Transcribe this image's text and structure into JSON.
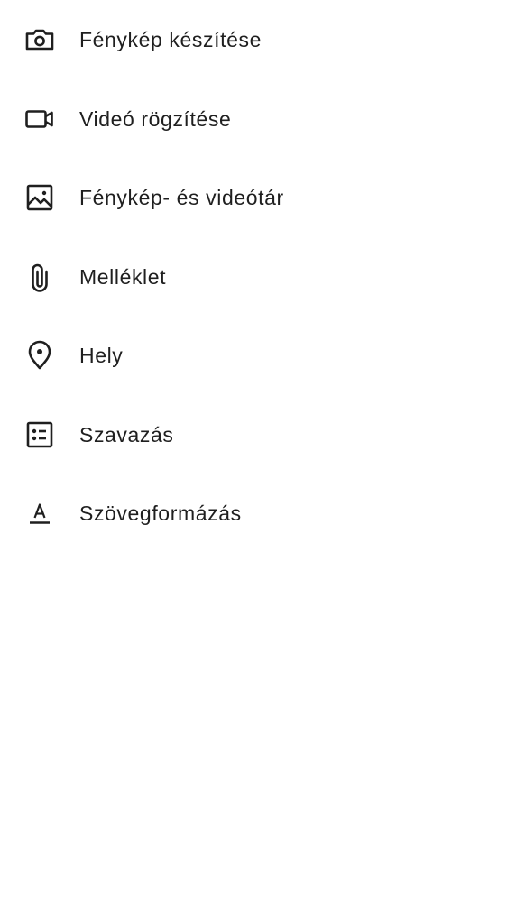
{
  "menu": {
    "items": [
      {
        "label": "Fénykép készítése",
        "icon": "camera-icon"
      },
      {
        "label": "Videó rögzítése",
        "icon": "videocam-icon"
      },
      {
        "label": "Fénykép- és videótár",
        "icon": "image-icon"
      },
      {
        "label": "Melléklet",
        "icon": "attachment-icon"
      },
      {
        "label": "Hely",
        "icon": "location-pin-icon"
      },
      {
        "label": "Szavazás",
        "icon": "poll-icon"
      },
      {
        "label": "Szövegformázás",
        "icon": "text-format-icon"
      }
    ]
  },
  "colors": {
    "background": "#ffffff",
    "text": "#1f1f1f",
    "icon": "#1f1f1f"
  }
}
